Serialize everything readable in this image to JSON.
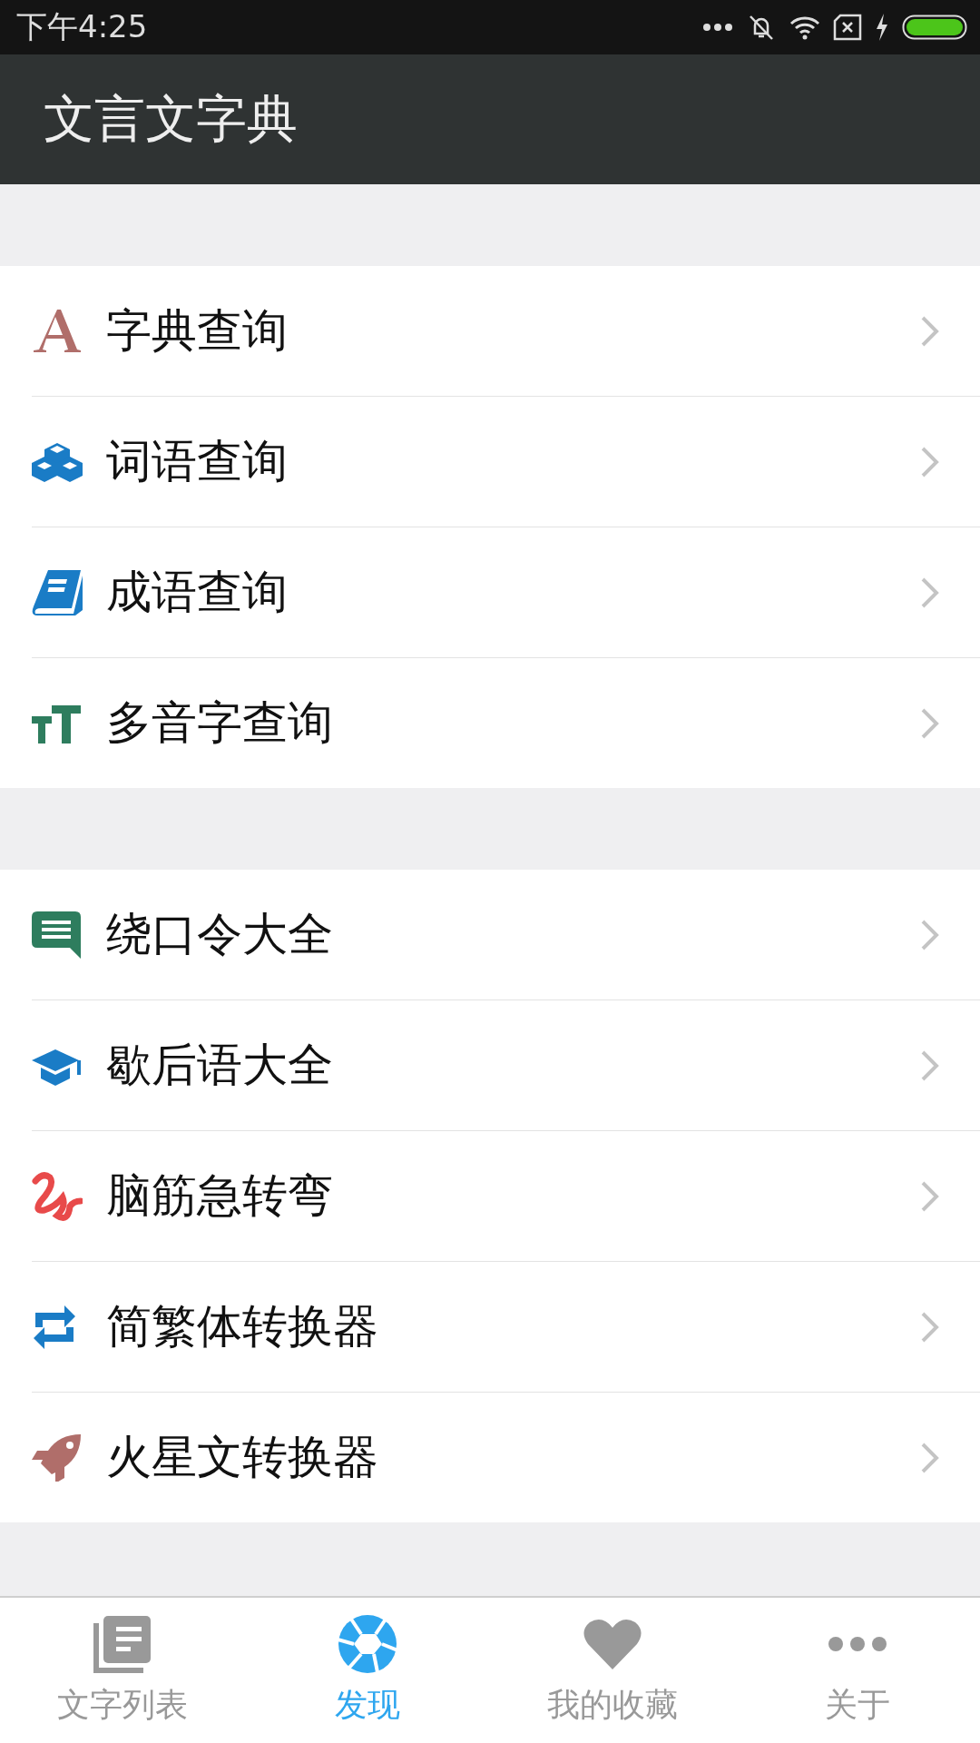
{
  "status_bar": {
    "time": "下午4:25"
  },
  "app_bar": {
    "title": "文言文字典"
  },
  "sections": [
    {
      "items": [
        {
          "kind": "letter",
          "label": "字典查询"
        },
        {
          "kind": "cubes",
          "label": "词语查询"
        },
        {
          "kind": "book",
          "label": "成语查询"
        },
        {
          "kind": "text-size",
          "label": "多音字查询"
        }
      ]
    },
    {
      "items": [
        {
          "kind": "chat",
          "label": "绕口令大全"
        },
        {
          "kind": "cap",
          "label": "歇后语大全"
        },
        {
          "kind": "squiggle",
          "label": "脑筋急转弯"
        },
        {
          "kind": "swap",
          "label": "简繁体转换器"
        },
        {
          "kind": "rocket",
          "label": "火星文转换器"
        }
      ]
    }
  ],
  "tabs": [
    {
      "kind": "list",
      "label": "文字列表",
      "selected": false
    },
    {
      "kind": "aperture",
      "label": "发现",
      "selected": true
    },
    {
      "kind": "heart",
      "label": "我的收藏",
      "selected": false
    },
    {
      "kind": "dots",
      "label": "关于",
      "selected": false
    }
  ]
}
